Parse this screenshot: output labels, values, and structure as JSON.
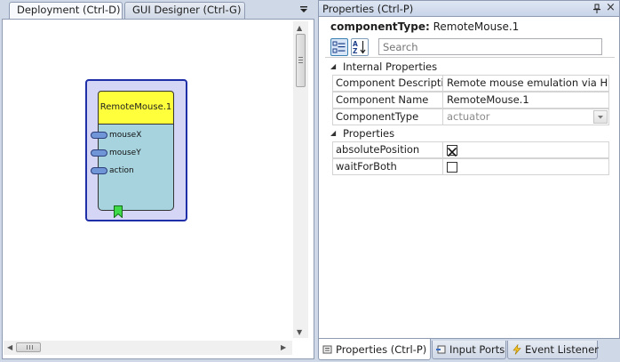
{
  "tabs": {
    "deployment": "Deployment (Ctrl-D)",
    "gui_designer": "GUI Designer (Ctrl-G)"
  },
  "component": {
    "title": "RemoteMouse.1",
    "input_ports": [
      "mouseX",
      "mouseY",
      "action"
    ]
  },
  "properties_panel": {
    "title": "Properties (Ctrl-P)",
    "component_type_label": "componentType:",
    "component_type_value": "RemoteMouse.1",
    "search_placeholder": "Search",
    "categories": {
      "internal": "Internal Properties",
      "properties": "Properties"
    },
    "internal_rows": [
      {
        "name": "Component Descriptic",
        "value": "Remote mouse emulation via HID"
      },
      {
        "name": "Component Name",
        "value": "RemoteMouse.1"
      },
      {
        "name": "ComponentType",
        "value": "actuator"
      }
    ],
    "property_rows": [
      {
        "name": "absolutePosition",
        "checked": true
      },
      {
        "name": "waitForBoth",
        "checked": false
      }
    ]
  },
  "bottom_tabs": {
    "properties": "Properties (Ctrl-P)",
    "input_ports": "Input Ports",
    "event_listener": "Event Listener"
  },
  "colors": {
    "component_header": "#ffff3c",
    "component_body": "#a6d3de",
    "component_frame": "#1f2fa8",
    "port": "#7096d8",
    "event_port": "#3fd94a"
  }
}
